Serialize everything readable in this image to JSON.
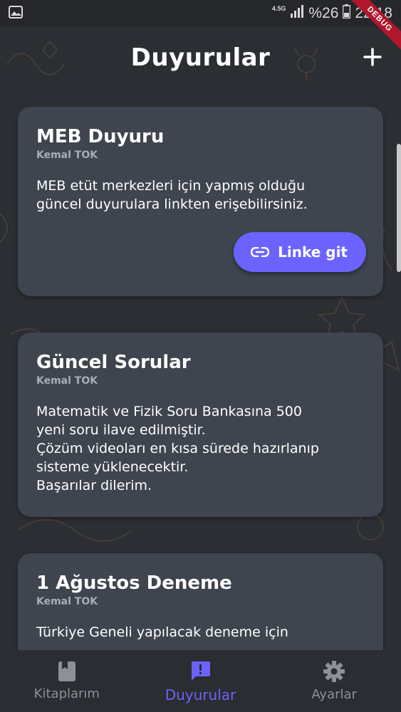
{
  "status_bar": {
    "network": "4.5G",
    "battery": "%26",
    "time": "22:18",
    "debug_label": "DEBUG"
  },
  "header": {
    "title": "Duyurular",
    "add_icon": "plus-icon"
  },
  "announcements": [
    {
      "title": "MEB Duyuru",
      "author": "Kemal TOK",
      "body": "MEB etüt merkezleri için yapmış olduğu\ngüncel duyurulara linkten erişebilirsiniz.",
      "link_label": "Linke git",
      "link_icon": "link-icon"
    },
    {
      "title": "Güncel Sorular",
      "author": "Kemal TOK",
      "body": "Matematik ve Fizik Soru Bankasına 500\nyeni soru ilave edilmiştir.\nÇözüm videoları en kısa sürede hazırlanıp\nsisteme yüklenecektir.\nBaşarılar dilerim."
    },
    {
      "title": "1 Ağustos Deneme",
      "author": "Kemal TOK",
      "body": "Türkiye Geneli yapılacak deneme için"
    }
  ],
  "bottom_nav": {
    "items": [
      {
        "label": "Kitaplarım",
        "icon": "book-icon",
        "active": false
      },
      {
        "label": "Duyurular",
        "icon": "announcement-icon",
        "active": true
      },
      {
        "label": "Ayarlar",
        "icon": "gear-icon",
        "active": false
      }
    ]
  },
  "colors": {
    "accent": "#6c63ff",
    "background": "#2b2e33",
    "card": "#3f454e",
    "debug": "#b0172c"
  }
}
